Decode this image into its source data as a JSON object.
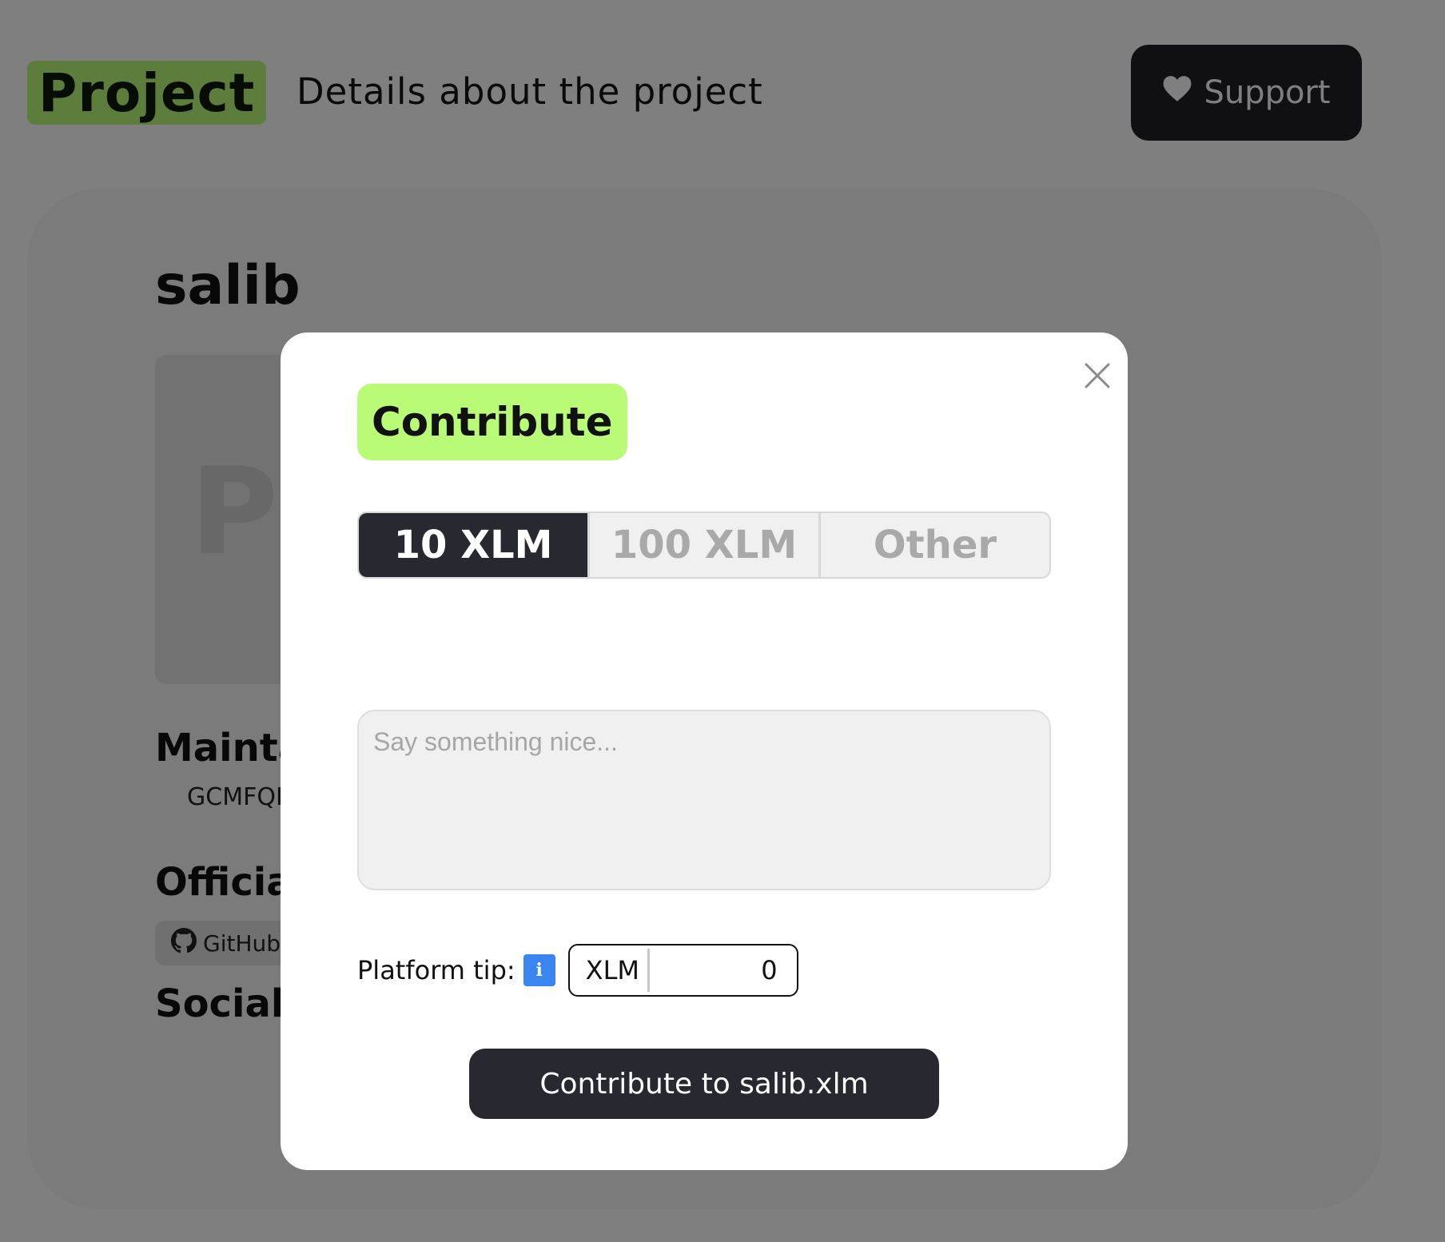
{
  "header": {
    "page_badge": "Project",
    "subtitle": "Details about the project",
    "support_label": "Support"
  },
  "project": {
    "name": "salib",
    "image_placeholder": "Pr",
    "maintainers_title": "Mainta",
    "maintainer_address": "GCMFQF",
    "official_title": "Official",
    "github_label": "GitHub",
    "socials_title": "Socials"
  },
  "modal": {
    "title": "Contribute",
    "amount_options": [
      {
        "label": "10 XLM",
        "selected": true
      },
      {
        "label": "100 XLM",
        "selected": false
      },
      {
        "label": "Other",
        "selected": false
      }
    ],
    "message_placeholder": "Say something nice...",
    "tip_label": "Platform tip:",
    "info_icon": "i",
    "tip_currency": "XLM",
    "tip_value": "0",
    "submit_label": "Contribute to salib.xlm"
  },
  "colors": {
    "accent_green": "#b9fa77",
    "dark": "#272830",
    "info_blue": "#3a86f0"
  },
  "icons": [
    "heart-icon",
    "github-icon",
    "close-icon",
    "info-icon"
  ]
}
